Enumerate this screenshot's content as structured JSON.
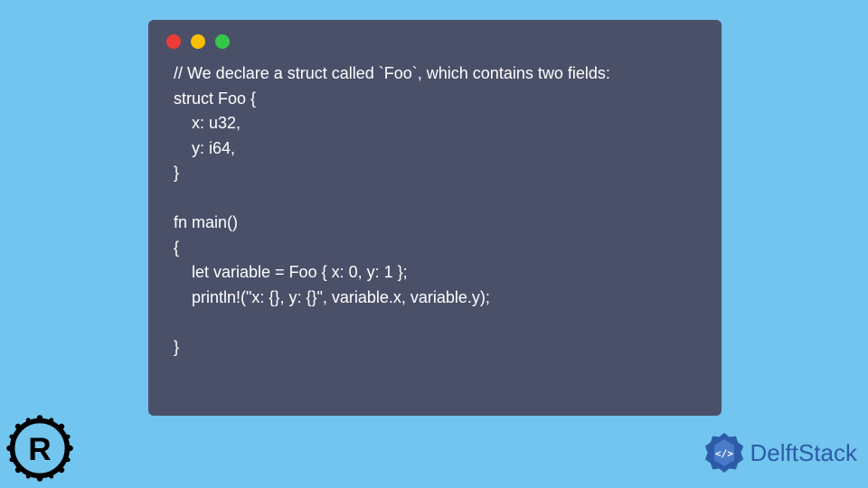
{
  "code": {
    "lines": [
      "// We declare a struct called `Foo`, which contains two fields:",
      "struct Foo {",
      "    x: u32,",
      "    y: i64,",
      "}",
      "",
      "fn main()",
      "{",
      "    let variable = Foo { x: 0, y: 1 };",
      "    println!(\"x: {}, y: {}\", variable.x, variable.y);",
      "",
      "}"
    ]
  },
  "brand": {
    "name": "DelftStack"
  }
}
